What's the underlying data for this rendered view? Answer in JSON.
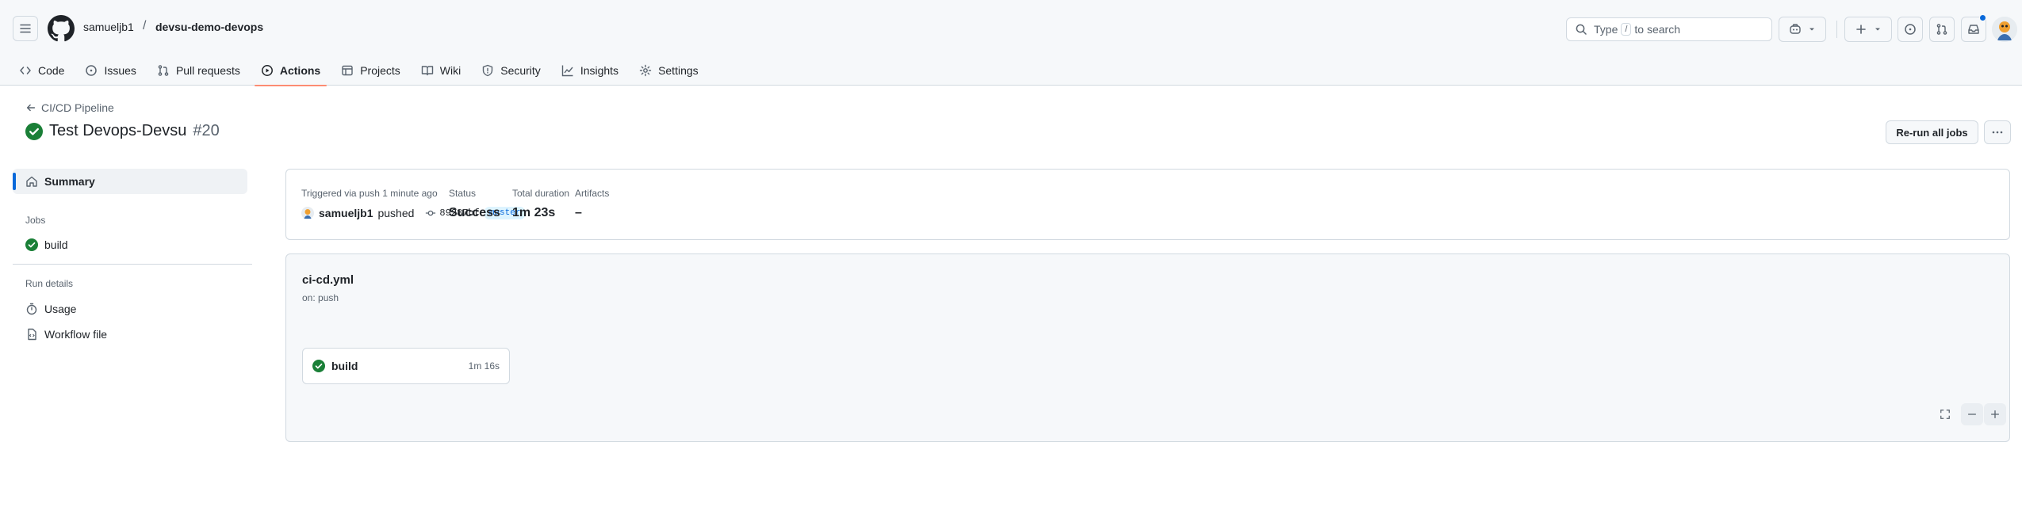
{
  "header": {
    "owner": "samueljb1",
    "separator": "/",
    "repo": "devsu-demo-devops",
    "search_prefix": "Type",
    "search_key": "/",
    "search_suffix": "to search"
  },
  "nav": {
    "code": "Code",
    "issues": "Issues",
    "pulls": "Pull requests",
    "actions": "Actions",
    "projects": "Projects",
    "wiki": "Wiki",
    "security": "Security",
    "insights": "Insights",
    "settings": "Settings",
    "active": "Actions"
  },
  "run": {
    "back_label": "CI/CD Pipeline",
    "title": "Test Devops-Devsu",
    "number": "#20",
    "rerun_label": "Re-run all jobs"
  },
  "sidebar": {
    "summary": "Summary",
    "jobs_heading": "Jobs",
    "job": "build",
    "run_details_heading": "Run details",
    "usage": "Usage",
    "workflow_file": "Workflow file"
  },
  "summary": {
    "triggered": "Triggered via push 1 minute ago",
    "user": "samueljb1",
    "action": "pushed",
    "sha": "89287bf",
    "branch": "master",
    "status_label": "Status",
    "status_value": "Success",
    "duration_label": "Total duration",
    "duration_value": "1m 23s",
    "artifacts_label": "Artifacts",
    "artifacts_value": "–"
  },
  "workflow": {
    "name": "ci-cd.yml",
    "trigger": "on: push",
    "job_name": "build",
    "job_duration": "1m 16s"
  },
  "colors": {
    "success": "#1a7f37",
    "accent": "#0969da",
    "active_tab": "#fd8c73"
  }
}
